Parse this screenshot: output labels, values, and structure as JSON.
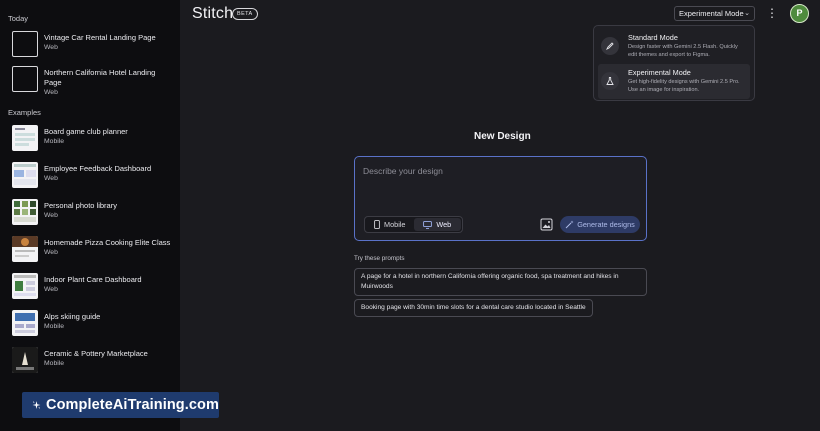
{
  "header": {
    "brand": "Stitch",
    "badge": "BETA",
    "mode_selected": "Experimental Mode",
    "avatar_initial": "P"
  },
  "dropdown": {
    "options": [
      {
        "title": "Standard Mode",
        "description": "Design faster with Gemini 2.5 Flash. Quickly edit themes and export to Figma.",
        "icon": "brush-icon"
      },
      {
        "title": "Experimental Mode",
        "description": "Get high-fidelity designs with Gemini 2.5 Pro. Use an image for inspiration.",
        "icon": "flask-icon"
      }
    ]
  },
  "sidebar": {
    "today_label": "Today",
    "today": [
      {
        "title": "Vintage Car Rental Landing Page",
        "subtitle": "Web"
      },
      {
        "title": "Northern California Hotel Landing Page",
        "subtitle": "Web"
      }
    ],
    "examples_label": "Examples",
    "examples": [
      {
        "title": "Board game club planner",
        "subtitle": "Mobile"
      },
      {
        "title": "Employee Feedback Dashboard",
        "subtitle": "Web"
      },
      {
        "title": "Personal photo library",
        "subtitle": "Web"
      },
      {
        "title": "Homemade Pizza Cooking Elite Class",
        "subtitle": "Web"
      },
      {
        "title": "Indoor Plant Care Dashboard",
        "subtitle": "Web"
      },
      {
        "title": "Alps skiing guide",
        "subtitle": "Mobile"
      },
      {
        "title": "Ceramic & Pottery Marketplace",
        "subtitle": "Mobile"
      }
    ]
  },
  "main": {
    "title": "New Design",
    "placeholder": "Describe your design",
    "toggle": {
      "mobile": "Mobile",
      "web": "Web",
      "active": "web"
    },
    "generate_label": "Generate designs",
    "prompts_label": "Try these prompts",
    "prompts": [
      "A page for a hotel in northern California offering organic food, spa treatment and hikes in Muirwoods",
      "Booking page with 30min time slots for a dental care studio located in Seattle"
    ]
  },
  "watermark": {
    "text": "CompleteAiTraining.com"
  },
  "colors": {
    "background": "#1b1b1f",
    "sidebar": "#0d0d10",
    "accent_border": "#5a72c8",
    "generate_bg": "#2e3b66",
    "watermark_bg": "#1f3b6e"
  }
}
